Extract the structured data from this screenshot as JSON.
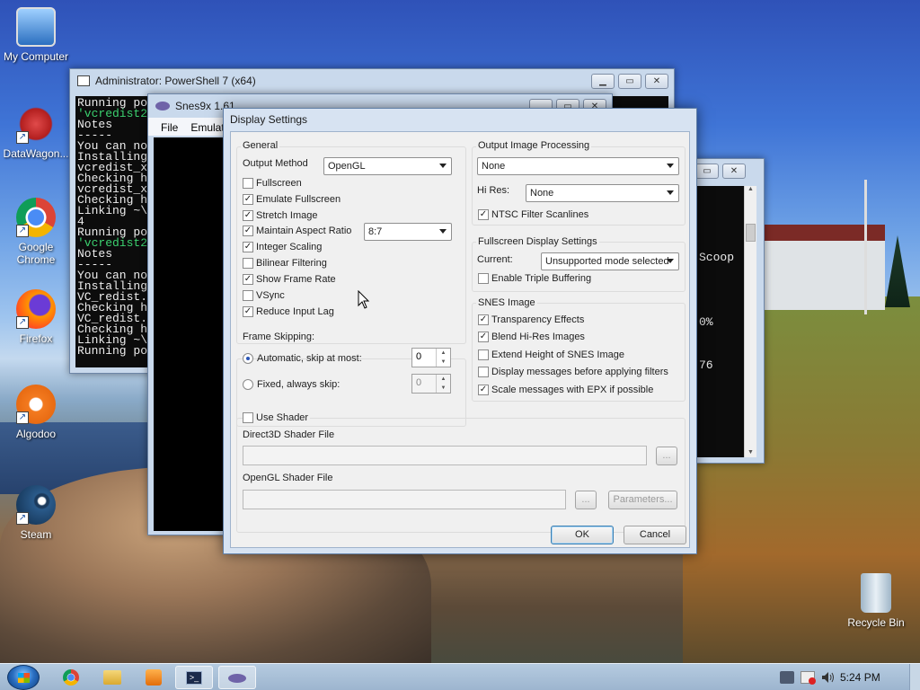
{
  "desktop": {
    "icons": [
      {
        "label": "My Computer",
        "icon": "computer-icon"
      },
      {
        "label": "DataWagon...",
        "icon": "datawagon-icon"
      },
      {
        "label": "Google Chrome",
        "icon": "chrome-icon"
      },
      {
        "label": "Firefox",
        "icon": "firefox-icon"
      },
      {
        "label": "Algodoo",
        "icon": "algodoo-icon"
      },
      {
        "label": "Steam",
        "icon": "steam-icon"
      },
      {
        "label": "Recycle Bin",
        "icon": "recycle-bin-icon"
      }
    ]
  },
  "powershell": {
    "title": "Administrator: PowerShell 7 (x64)",
    "lines": [
      "Running po",
      "'vcredist2",
      "Notes",
      "-----",
      "You can no",
      "Installing",
      "vcredist_x",
      "Checking h",
      "vcredist_x",
      "Checking h",
      "Linking ~\\",
      "4",
      "Running po",
      "'vcredist2",
      "Notes",
      "-----",
      "You can no",
      "Installing",
      "VC_redist.",
      "Checking h",
      "VC_redist.",
      "Checking h",
      "Linking ~\\",
      "Running po"
    ]
  },
  "console2": {
    "lines": [
      "",
      "",
      "",
      "",
      "",
      "",
      "Scoop",
      "",
      "",
      "",
      "",
      "",
      "0%",
      "",
      "",
      "",
      "76"
    ]
  },
  "snes": {
    "title": "Snes9x 1.61",
    "menu": [
      "File",
      "Emulat"
    ]
  },
  "dialog": {
    "title": "Display Settings",
    "general": {
      "label": "General",
      "output_method_label": "Output Method",
      "output_method_value": "OpenGL",
      "aspect_value": "8:7",
      "options": [
        {
          "label": "Fullscreen",
          "checked": false
        },
        {
          "label": "Emulate Fullscreen",
          "checked": true
        },
        {
          "label": "Stretch Image",
          "checked": true
        },
        {
          "label": "Maintain Aspect Ratio",
          "checked": true
        },
        {
          "label": "Integer Scaling",
          "checked": true
        },
        {
          "label": "Bilinear Filtering",
          "checked": false
        },
        {
          "label": "Show Frame Rate",
          "checked": true
        },
        {
          "label": "VSync",
          "checked": false
        },
        {
          "label": "Reduce Input Lag",
          "checked": true
        }
      ]
    },
    "frame_skipping": {
      "label": "Frame Skipping:",
      "auto_label": "Automatic, skip at most:",
      "auto_value": "0",
      "fixed_label": "Fixed, always skip:",
      "fixed_value": "0",
      "selected": "auto"
    },
    "output_processing": {
      "label": "Output Image Processing",
      "value": "None",
      "hires_label": "Hi Res:",
      "hires_value": "None",
      "ntsc_label": "NTSC Filter Scanlines",
      "ntsc_checked": true
    },
    "fullscreen": {
      "label": "Fullscreen Display Settings",
      "current_label": "Current:",
      "current_value": "Unsupported mode selected",
      "triple_label": "Enable Triple Buffering",
      "triple_checked": false
    },
    "snes_image": {
      "label": "SNES Image",
      "options": [
        {
          "label": "Transparency Effects",
          "checked": true
        },
        {
          "label": "Blend Hi-Res Images",
          "checked": true
        },
        {
          "label": "Extend Height of SNES Image",
          "checked": false
        },
        {
          "label": "Display messages before applying filters",
          "checked": false
        },
        {
          "label": "Scale messages with EPX if possible",
          "checked": true
        }
      ]
    },
    "shader": {
      "use_label": "Use Shader",
      "use_checked": false,
      "d3d_label": "Direct3D Shader File",
      "d3d_value": "",
      "gl_label": "OpenGL Shader File",
      "gl_value": "",
      "browse_label": "...",
      "params_label": "Parameters..."
    },
    "ok_label": "OK",
    "cancel_label": "Cancel"
  },
  "taskbar": {
    "items": [
      "chrome-icon",
      "explorer-icon",
      "media-player-icon",
      "powershell-icon",
      "snes9x-icon"
    ],
    "time": "5:24 PM"
  }
}
